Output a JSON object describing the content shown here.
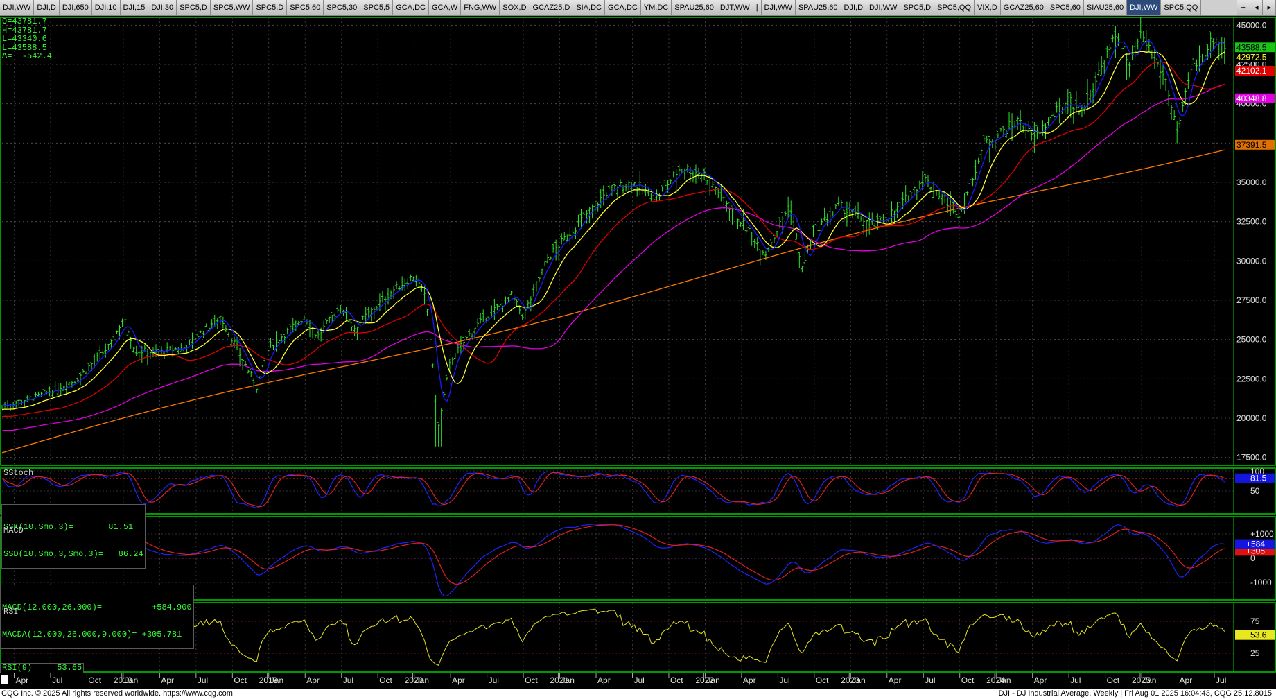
{
  "tabs": [
    "DJI,WW",
    "DJI,D",
    "DJI,650",
    "DJI,10",
    "DJI,15",
    "DJI,30",
    "SPC5,D",
    "SPC5,WW",
    "SPC5,D",
    "SPC5,60",
    "SPC5,30",
    "SPC5,5",
    "GCA,DC",
    "GCA,W",
    "FNG,WW",
    "SOX,D",
    "GCAZ25,D",
    "SIA,DC",
    "GCA,DC",
    "YM,DC",
    "SPAU25,60",
    "DJT,WW",
    "|",
    "DJI,WW",
    "SPAU25,60",
    "DJI,D",
    "DJI,WW",
    "SPC5,D",
    "SPC5,QQ",
    "VIX,D",
    "GCAZ25,60",
    "SPC5,60",
    "SIAU25,60",
    "DJI,WW",
    "SPC5,QQ"
  ],
  "active_tab_index": 33,
  "tab_controls": [
    "+",
    "◂",
    "▸"
  ],
  "ohlc": {
    "open": "O=43781.7",
    "high": "H=43781.7",
    "low": "L=43340.6",
    "last": "L=43588.5",
    "delta": "Δ=  -542.4"
  },
  "price_scale": [
    "45000.0",
    "42500.0",
    "40000.0",
    "37500.0",
    "35000.0",
    "32500.0",
    "30000.0",
    "27500.0",
    "25000.0",
    "22500.0",
    "20000.0",
    "17500.0"
  ],
  "price_tags": [
    {
      "label": "43588.5",
      "bg": "#19c419",
      "fg": "#000"
    },
    {
      "label": "42972.5",
      "bg": "#000",
      "fg": "#ffff30"
    },
    {
      "label": "42102.1",
      "bg": "#e00000",
      "fg": "#fff"
    },
    {
      "label": "40348.8",
      "bg": "#e000e0",
      "fg": "#fff"
    },
    {
      "label": "37391.5",
      "bg": "#e07000",
      "fg": "#000"
    }
  ],
  "sstoch": {
    "title": "SStoch",
    "ssk": "SSK(10,Smo,3)=       81.51",
    "ssd": "SSD(10,Smo,3,Smo,3)=   86.24",
    "scale": [
      "100",
      "50"
    ],
    "tag": "81.5"
  },
  "macd": {
    "title": "MACD",
    "macd_line": "MACD(12.000,26.000)=          +584.900",
    "macda_line": "MACDA(12.000,26.000,9.000)= +305.781",
    "scale": [
      "+1000",
      "0",
      "-1000"
    ],
    "tag_macd": "+584",
    "tag_macda": "+305"
  },
  "rsi": {
    "title": "RSI",
    "value_line": "RSI(9)=    53.65",
    "scale": [
      "75",
      "25"
    ],
    "tag": "53.6"
  },
  "time_axis": [
    "Apr",
    "Jul",
    "Oct",
    "2018",
    "Jan",
    "Apr",
    "Jul",
    "Oct",
    "2019",
    "Jan",
    "Apr",
    "Jul",
    "Oct",
    "2020",
    "Jan",
    "Apr",
    "Jul",
    "Oct",
    "2021",
    "Jan",
    "Apr",
    "Jul",
    "Oct",
    "2022",
    "Jan",
    "Apr",
    "Jul",
    "Oct",
    "2023",
    "Jan",
    "Apr",
    "Jul",
    "Oct",
    "2024",
    "Jan",
    "Apr",
    "Jul",
    "Oct",
    "2025",
    "Jan",
    "Apr",
    "Jul"
  ],
  "footer": {
    "left": "CQG Inc. © 2025 All rights reserved worldwide. https://www.cqg.com",
    "right": "DJI - DJ Industrial Average, Weekly | Fri Aug 01 2025 16:04:43, CQG 25.12.8015"
  },
  "colors": {
    "bars": "#2ee62e",
    "ma_fast": "#1a1aff",
    "ma_10": "#ffff30",
    "ma_20": "#e00000",
    "ma_50": "#e000e0",
    "ma_200": "#ff7a00",
    "pane_border": "#00cc00"
  },
  "chart_data": {
    "type": "ohlc",
    "title": "DJI - DJ Industrial Average, Weekly",
    "x": [
      "2017-04",
      "2017-07",
      "2017-10",
      "2018-01",
      "2018-04",
      "2018-07",
      "2018-10",
      "2019-01",
      "2019-04",
      "2019-07",
      "2019-10",
      "2020-01",
      "2020-03",
      "2020-04",
      "2020-07",
      "2020-10",
      "2021-01",
      "2021-04",
      "2021-07",
      "2021-10",
      "2022-01",
      "2022-04",
      "2022-07",
      "2022-10",
      "2023-01",
      "2023-04",
      "2023-07",
      "2023-10",
      "2024-01",
      "2024-04",
      "2024-07",
      "2024-10",
      "2025-01",
      "2025-04",
      "2025-07"
    ],
    "series": [
      {
        "name": "DJI",
        "values": [
          20800,
          21500,
          23000,
          26200,
          24200,
          25300,
          26500,
          23300,
          26400,
          27000,
          27000,
          28800,
          19200,
          23700,
          26400,
          28000,
          30800,
          34000,
          34800,
          35500,
          35000,
          33000,
          31500,
          30500,
          33700,
          34000,
          35000,
          33000,
          38000,
          39000,
          40500,
          42500,
          43800,
          39500,
          44500
        ]
      }
    ],
    "ylim": [
      17000,
      45500
    ],
    "yticks": [
      17500,
      20000,
      22500,
      25000,
      27500,
      30000,
      32500,
      35000,
      37500,
      40000,
      42500,
      45000
    ]
  }
}
